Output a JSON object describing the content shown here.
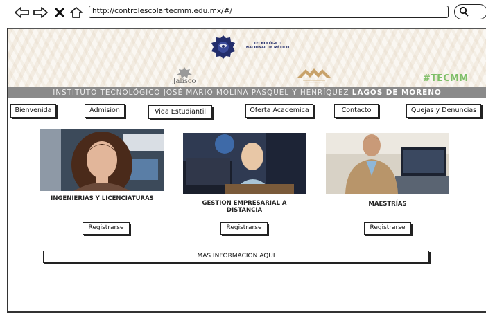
{
  "browser": {
    "url": "http://controlescolartecmm.edu.mx/#/",
    "icons": [
      "back-arrow-icon",
      "forward-arrow-icon",
      "close-icon",
      "home-icon",
      "search-icon"
    ]
  },
  "header": {
    "tec_logo_line1": "TECNOLÓGICO",
    "tec_logo_line2": "NACIONAL DE MÉXICO",
    "jalisco": "Jalisco",
    "hashtag": "#TECMM",
    "institute_prefix": "INSTITUTO TECNOLÓGICO JOSÉ MARIO MOLINA PASQUEL Y HENRÍQUEZ",
    "institute_campus": "LAGOS DE MORENO"
  },
  "nav": {
    "items": [
      "Bienvenida",
      "Admision",
      "Vida Estudiantil",
      "Oferta Academica",
      "Contacto",
      "Quejas y Denuncias"
    ]
  },
  "cards": [
    {
      "title": "INGENIERIAS Y LICENCIATURAS",
      "button": "Registrarse"
    },
    {
      "title": "GESTION EMPRESARIAL A DISTANCIA",
      "button": "Registrarse"
    },
    {
      "title": "MAESTRÍAS",
      "button": "Registrarse"
    }
  ],
  "more_info": "MAS INFORMACION AQUI",
  "colors": {
    "hashtag_green": "#7fbf69",
    "institute_bar": "#8a8a8a",
    "tec_navy": "#222d6b",
    "ministry_gold": "#c8a26a"
  }
}
